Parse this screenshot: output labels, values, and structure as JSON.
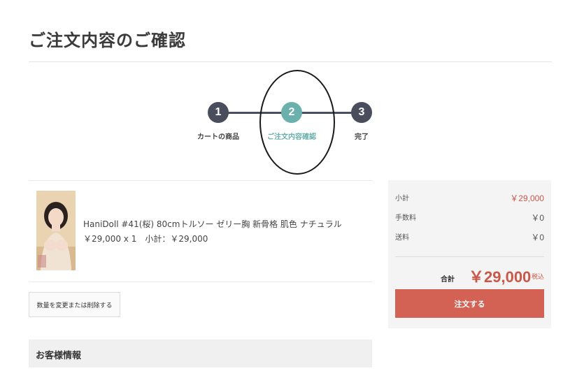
{
  "page": {
    "title": "ご注文内容のご確認"
  },
  "stepper": {
    "steps": [
      {
        "number": "1",
        "label": "カートの商品",
        "color": "#4a4d5c",
        "active": false
      },
      {
        "number": "2",
        "label": "ご注文内容確認",
        "color": "#6ab0ad",
        "active": true
      },
      {
        "number": "3",
        "label": "完了",
        "color": "#4a4d5c",
        "active": false
      }
    ]
  },
  "cart_item": {
    "name": "HaniDoll #41(桜) 80cmトルソー ゼリー胸 新骨格 肌色 ナチュラル",
    "price_line": "￥29,000 x 1　小計：￥29,000"
  },
  "change_button": {
    "label": "数量を変更または削除する"
  },
  "customer_info": {
    "title": "お客様情報"
  },
  "summary": {
    "rows": [
      {
        "label": "小計",
        "value": "￥29,000",
        "accent": true
      },
      {
        "label": "手数料",
        "value": "￥0",
        "accent": false
      },
      {
        "label": "送料",
        "value": "￥0",
        "accent": false
      }
    ],
    "total_label": "合計",
    "total_value": "￥29,000",
    "tax_label": "税込",
    "order_button": "注文する"
  },
  "colors": {
    "accent": "#d36254",
    "step_active": "#6ab0ad",
    "step_inactive": "#4a4d5c"
  }
}
